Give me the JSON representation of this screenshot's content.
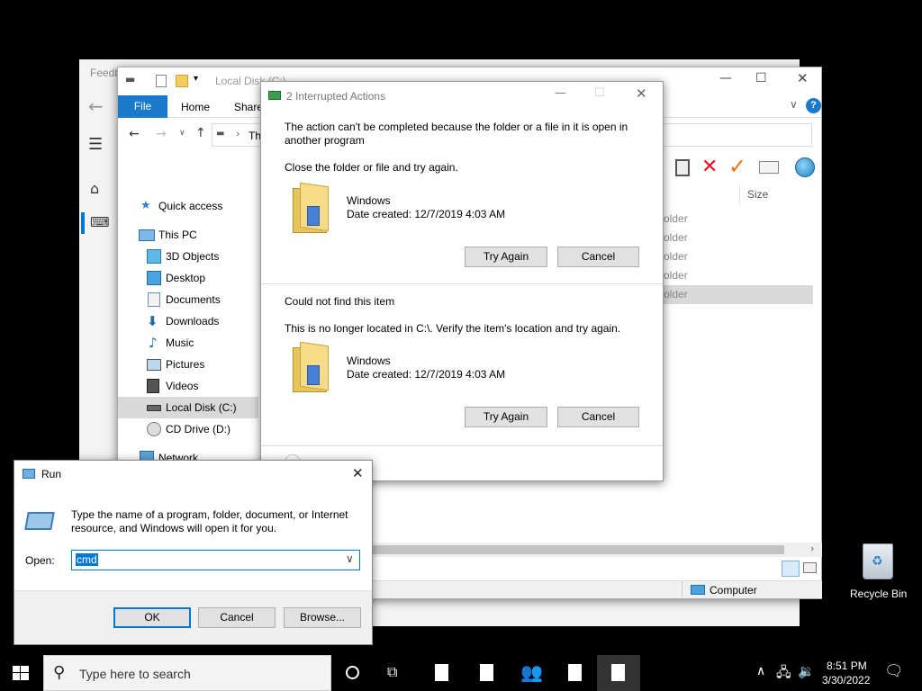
{
  "feedback_window": {
    "title": "Feedb"
  },
  "explorer": {
    "title": "Local Disk (C:)",
    "ribbon_tabs": [
      "File",
      "Home",
      "Share"
    ],
    "address_partial": "Th",
    "column_size": "Size",
    "folder_rows": [
      "older",
      "older",
      "older",
      "older",
      "older"
    ],
    "nav": {
      "quick_access": "Quick access",
      "this_pc": "This PC",
      "objects3d": "3D Objects",
      "desktop": "Desktop",
      "documents": "Documents",
      "downloads": "Downloads",
      "music": "Music",
      "pictures": "Pictures",
      "videos": "Videos",
      "local_disk": "Local Disk (C:)",
      "cd_drive": "CD Drive (D:)",
      "network": "Network"
    },
    "status_location": "Computer",
    "help_glyph": "?"
  },
  "dialog": {
    "title": "2 Interrupted Actions",
    "section1": {
      "message": "The action can't be completed because the folder or a file in it is open in another program",
      "instruction": "Close the folder or file and try again.",
      "item_name": "Windows",
      "item_date": "Date created: 12/7/2019 4:03 AM",
      "try_again": "Try Again",
      "cancel": "Cancel"
    },
    "section2": {
      "message": "Could not find this item",
      "instruction": "This is no longer located in C:\\. Verify the item's location and try again.",
      "item_name": "Windows",
      "item_date": "Date created: 12/7/2019 4:03 AM",
      "try_again": "Try Again",
      "cancel": "Cancel"
    }
  },
  "run_dialog": {
    "title": "Run",
    "description": "Type the name of a program, folder, document, or Internet resource, and Windows will open it for you.",
    "open_label": "Open:",
    "open_value": "cmd",
    "ok": "OK",
    "cancel": "Cancel",
    "browse": "Browse..."
  },
  "desktop": {
    "recycle_bin": "Recycle Bin"
  },
  "taskbar": {
    "search_placeholder": "Type here to search",
    "time": "8:51 PM",
    "date": "3/30/2022"
  },
  "colors": {
    "accent": "#0078d7",
    "taskbar_bg": "#000000",
    "delete_red": "#e81123",
    "check_orange": "#e8731a"
  }
}
